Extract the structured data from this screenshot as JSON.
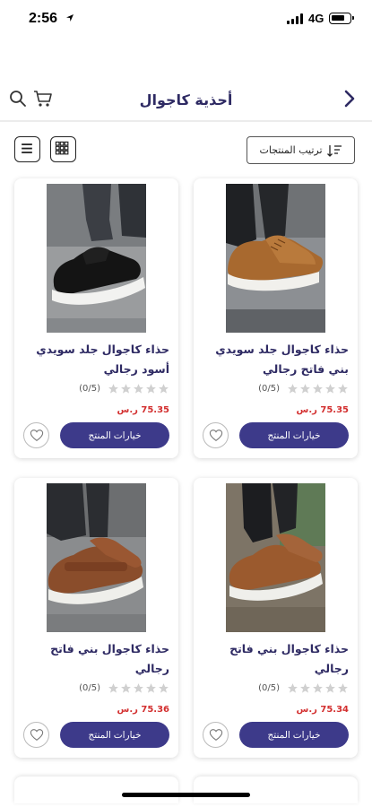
{
  "status_bar": {
    "time": "2:56",
    "network": "4G"
  },
  "header": {
    "title": "أحذية كاجوال"
  },
  "toolbar": {
    "sort_label": "ترتيب المنتجات"
  },
  "products": [
    {
      "name": "حذاء كاجوال جلد سويدي بني فاتح رجالي",
      "rating": "(0/5)",
      "price": "75.35 ر.س",
      "options_label": "خيارات المنتج",
      "image": "brown-suede-shoe"
    },
    {
      "name": "حذاء كاجوال جلد سويدي أسود رجالي",
      "rating": "(0/5)",
      "price": "75.35 ر.س",
      "options_label": "خيارات المنتج",
      "image": "black-suede-shoe"
    },
    {
      "name": "حذاء كاجوال بني فاتح رجالي",
      "rating": "(0/5)",
      "price": "75.34 ر.س",
      "options_label": "خيارات المنتج",
      "image": "brown-leather-shoe"
    },
    {
      "name": "حذاء كاجوال بني فاتح رجالي",
      "rating": "(0/5)",
      "price": "75.36 ر.س",
      "options_label": "خيارات المنتج",
      "image": "brown-leather-strap-shoe"
    }
  ],
  "colors": {
    "brand": "#3d3a8a",
    "title": "#2e2a63",
    "price": "#d32f2f"
  }
}
